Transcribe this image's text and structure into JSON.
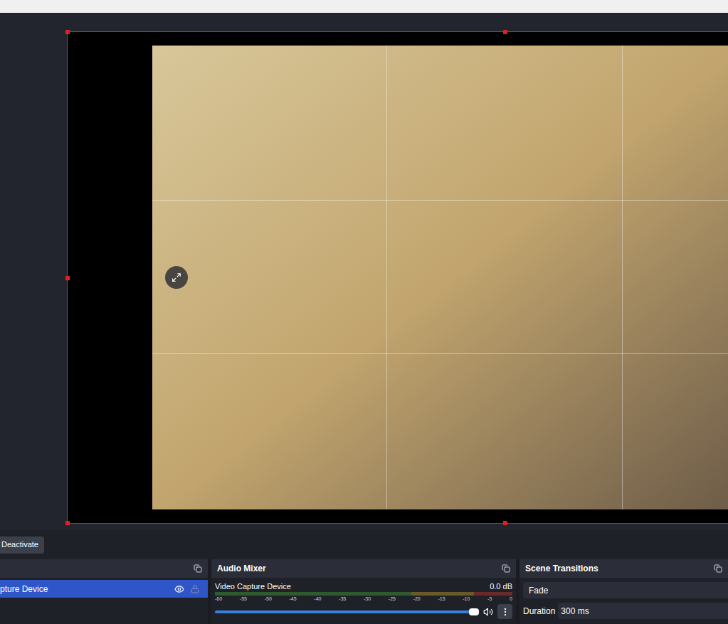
{
  "controls": {
    "deactivate_button": "Deactivate"
  },
  "sources": {
    "items": [
      {
        "name": "pture Device",
        "selected": true,
        "visible": true,
        "locked": false
      }
    ]
  },
  "audio_mixer": {
    "title": "Audio Mixer",
    "channels": [
      {
        "name": "Video Capture Device",
        "reading": "0.0 dB",
        "meter_level": 0,
        "volume": 1,
        "muted": false
      }
    ],
    "scale": [
      "-60",
      "-55",
      "-50",
      "-45",
      "-40",
      "-35",
      "-30",
      "-25",
      "-20",
      "-15",
      "-10",
      "-5",
      "0"
    ]
  },
  "scene_transitions": {
    "title": "Scene Transitions",
    "transition": "Fade",
    "duration_label": "Duration",
    "duration": "300 ms"
  }
}
